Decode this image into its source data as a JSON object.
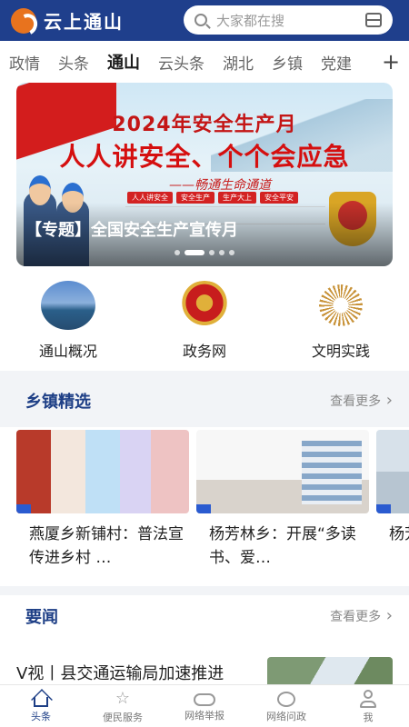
{
  "header": {
    "app_name": "云上通山",
    "search_placeholder": "大家都在搜"
  },
  "tabs": [
    {
      "label": "政情"
    },
    {
      "label": "头条"
    },
    {
      "label": "通山",
      "active": true
    },
    {
      "label": "云头条"
    },
    {
      "label": "湖北"
    },
    {
      "label": "乡镇"
    },
    {
      "label": "党建"
    }
  ],
  "banner": {
    "image_title": "2024年安全生产月",
    "image_slogan": "人人讲安全、个个会应急",
    "image_signature": "——畅通生命通道",
    "image_tags": [
      "人人讲安全",
      "安全生产",
      "生产大上",
      "安全平安"
    ],
    "caption": "【专题】全国安全生产宣传月",
    "page_count": 5,
    "active_page": 2
  },
  "quick_links": [
    {
      "label": "通山概况",
      "icon": "landscape-photo-icon"
    },
    {
      "label": "政务网",
      "icon": "national-emblem-icon"
    },
    {
      "label": "文明实践",
      "icon": "civilization-fan-icon"
    }
  ],
  "towns": {
    "title": "乡镇精选",
    "more": "查看更多",
    "items": [
      {
        "text": "燕厦乡新铺村：普法宣传进乡村 …"
      },
      {
        "text": "杨芳林乡：开展“多读书、爱…"
      },
      {
        "text": "杨芳…手八…"
      }
    ]
  },
  "news": {
    "title": "要闻",
    "more": "查看更多",
    "first": "V视丨县交通运输局加速推进"
  },
  "bottom_nav": [
    {
      "label": "头条",
      "icon": "home-icon",
      "active": true
    },
    {
      "label": "便民服务",
      "icon": "service-icon"
    },
    {
      "label": "网络举报",
      "icon": "report-icon"
    },
    {
      "label": "网络问政",
      "icon": "chat-icon"
    },
    {
      "label": "我",
      "icon": "user-icon"
    }
  ],
  "colors": {
    "header_bg": "#1f3f8c",
    "accent": "#1e3f86",
    "logo": "#e8731e"
  }
}
